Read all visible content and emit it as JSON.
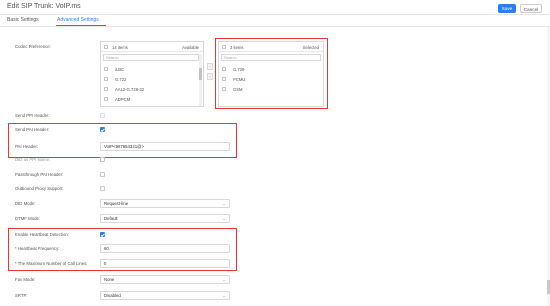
{
  "header": {
    "title": "Edit SIP Trunk: VoIP.ms",
    "save_label": "Save",
    "cancel_label": "Cancel"
  },
  "tabs": [
    {
      "label": "Basic Settings",
      "active": false
    },
    {
      "label": "Advanced Settings",
      "active": true
    }
  ],
  "codec": {
    "label": "Codec Preference:",
    "available": {
      "count": "14 items",
      "title": "Available",
      "search_placeholder": "Search",
      "items": [
        "iLBC",
        "G.722",
        "AAL2-G.726-32",
        "ADPCM"
      ]
    },
    "selected": {
      "count": "3 items",
      "title": "Selected",
      "search_placeholder": "Search",
      "items": [
        "G.729",
        "PCMU",
        "GSM"
      ]
    }
  },
  "fields": {
    "send_ppi_label": "Send PPI Header:",
    "send_pai_label": "Send PAI Header:",
    "send_pai_checked": true,
    "pai_header_label": "PAI Header:",
    "pai_header_value": "VoIP<987654321@>",
    "did_ppi_label": "DID as PPI Name:",
    "passthrough_pai_label": "Passthrough PAI Header:",
    "outbound_proxy_label": "Outbound Proxy Support:",
    "did_mode_label": "DID Mode:",
    "did_mode_value": "Request-line",
    "dtmf_mode_label": "DTMF Mode:",
    "dtmf_mode_value": "Default",
    "heartbeat_label": "Enable Heartbeat Detection:",
    "heartbeat_checked": true,
    "heartbeat_freq_label": "* Heartbeat Frequency:",
    "heartbeat_freq_value": "60",
    "max_call_lines_label": "* The Maximum Number of Call Lines:",
    "max_call_lines_value": "0",
    "fax_mode_label": "Fax Mode:",
    "fax_mode_value": "None",
    "srtp_label": "SRTP:",
    "srtp_value": "Disabled"
  },
  "colors": {
    "accent": "#2f7df6",
    "highlight_box": "#ee3333"
  }
}
